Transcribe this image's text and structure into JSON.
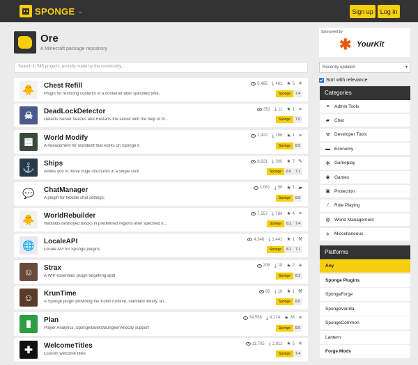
{
  "nav": {
    "brand": "SPONGE",
    "signup": "Sign up",
    "login": "Log in"
  },
  "header": {
    "title": "Ore",
    "subtitle": "A Minecraft package repository"
  },
  "sponsor": {
    "label": "Sponsored by",
    "name": "YourKit"
  },
  "search": {
    "placeholder": "Search in 545 projects, proudly made by the community..."
  },
  "sort": {
    "value": "Recently updated",
    "relevance_label": "Sort with relevance",
    "relevance_checked": true
  },
  "projects": [
    {
      "name": "Chest Refill",
      "desc": "Plugin for restoring contents of a container after specified time.",
      "views": "5,485",
      "downloads": "461",
      "stars": "5",
      "category_icon": "asterisk-icon",
      "platform": "Sponge",
      "versions": [
        "7.4"
      ],
      "icon_color": "#f2f2f2",
      "icon_glyph": "🐥"
    },
    {
      "name": "DeadLockDetector",
      "desc": "Detects Server freezes and Restarts the server with the help of th...",
      "views": "353",
      "downloads": "11",
      "stars": "1",
      "category_icon": "server-icon",
      "platform": "Sponge",
      "versions": [
        "7.0"
      ],
      "icon_color": "#4a5a8a",
      "icon_glyph": "☠"
    },
    {
      "name": "World Modify",
      "desc": "A replacement for worldedit that works on Sponge 8",
      "views": "1,422",
      "downloads": "166",
      "stars": "1",
      "category_icon": "server-icon",
      "platform": "Sponge",
      "versions": [
        "8.0"
      ],
      "icon_color": "#3a4a3a",
      "icon_glyph": "▦"
    },
    {
      "name": "Ships",
      "desc": "Allows you to move huge structures in a single click",
      "views": "8,821",
      "downloads": "300",
      "stars": "7",
      "category_icon": "pencil-icon",
      "platform": "Sponge",
      "versions": [
        "8.0",
        "7.1"
      ],
      "icon_color": "#2a3a4a",
      "icon_glyph": "⚓"
    },
    {
      "name": "ChatManager",
      "desc": "A plugin for flexible chat settings.",
      "views": "1,061",
      "downloads": "96",
      "stars": "1",
      "category_icon": "comment-icon",
      "platform": "Sponge",
      "versions": [
        "8.0"
      ],
      "icon_color": "#ffffff",
      "icon_glyph": "💬"
    },
    {
      "name": "WorldRebuilder",
      "desc": "Rebuilds destroyed blocks in predefined regions after specified ti...",
      "views": "7,557",
      "downloads": "784",
      "stars": "4",
      "category_icon": "server-icon",
      "platform": "Sponge",
      "versions": [
        "8.1",
        "7.4"
      ],
      "icon_color": "#f2f2f2",
      "icon_glyph": "🐥"
    },
    {
      "name": "LocaleAPI",
      "desc": "Locale API for Sponge plugins",
      "views": "4,346",
      "downloads": "1,441",
      "stars": "1",
      "category_icon": "wrench-icon",
      "platform": "Sponge",
      "versions": [
        "8.1",
        "7.1"
      ],
      "icon_color": "#e8e8f0",
      "icon_glyph": "🌐"
    },
    {
      "name": "Strax",
      "desc": "A WIP essentials plugin targetting api8",
      "views": "206",
      "downloads": "18",
      "stars": "2",
      "category_icon": "asterisk-icon",
      "platform": "Sponge",
      "versions": [
        "8.2"
      ],
      "icon_color": "#6a4a3a",
      "icon_glyph": "☺"
    },
    {
      "name": "KrunTime",
      "desc": "A Sponge plugin providing the Kotlin runtime, standard library, an...",
      "views": "95",
      "downloads": "10",
      "stars": "1",
      "category_icon": "wrench-icon",
      "platform": "Sponge",
      "versions": [
        "8.0"
      ],
      "icon_color": "#5a3a2a",
      "icon_glyph": "☺"
    },
    {
      "name": "Plan",
      "desc": "Player Analytics, Sponge/Bukkit/Bungee/Velocity support",
      "views": "34,558",
      "downloads": "4,124",
      "stars": "36",
      "category_icon": "server-icon",
      "platform": "Sponge",
      "versions": [
        "8.0"
      ],
      "icon_color": "#2e9e44",
      "icon_glyph": "▮"
    },
    {
      "name": "WelcomeTitles",
      "desc": "Custom welcome titles",
      "views": "11,705",
      "downloads": "2,811",
      "stars": "5",
      "category_icon": "asterisk-icon",
      "platform": "Sponge",
      "versions": [
        "7.4"
      ],
      "icon_color": "#111111",
      "icon_glyph": "✚"
    }
  ],
  "categories": {
    "title": "Categories",
    "items": [
      {
        "label": "Admin Tools",
        "icon": "server-icon",
        "glyph": "≡"
      },
      {
        "label": "Chat",
        "icon": "comment-icon",
        "glyph": "▰"
      },
      {
        "label": "Developer Tools",
        "icon": "wrench-icon",
        "glyph": "⚒"
      },
      {
        "label": "Economy",
        "icon": "money-icon",
        "glyph": "▬"
      },
      {
        "label": "Gameplay",
        "icon": "puzzle-icon",
        "glyph": "✥"
      },
      {
        "label": "Games",
        "icon": "gamepad-icon",
        "glyph": "◉"
      },
      {
        "label": "Protection",
        "icon": "lock-icon",
        "glyph": "▣"
      },
      {
        "label": "Role Playing",
        "icon": "magic-icon",
        "glyph": "⁄"
      },
      {
        "label": "World Management",
        "icon": "globe-icon",
        "glyph": "◍"
      },
      {
        "label": "Miscellaneous",
        "icon": "asterisk-icon",
        "glyph": "✳"
      }
    ]
  },
  "platforms": {
    "title": "Platforms",
    "items": [
      {
        "label": "Any",
        "active": true,
        "bold": true
      },
      {
        "label": "Sponge Plugins",
        "active": false,
        "bold": true
      },
      {
        "label": "SpongeForge",
        "active": false,
        "bold": false
      },
      {
        "label": "SpongeVanilla",
        "active": false,
        "bold": false
      },
      {
        "label": "SpongeCommon",
        "active": false,
        "bold": false
      },
      {
        "label": "Lantern",
        "active": false,
        "bold": false
      },
      {
        "label": "Forge Mods",
        "active": false,
        "bold": true
      }
    ]
  }
}
